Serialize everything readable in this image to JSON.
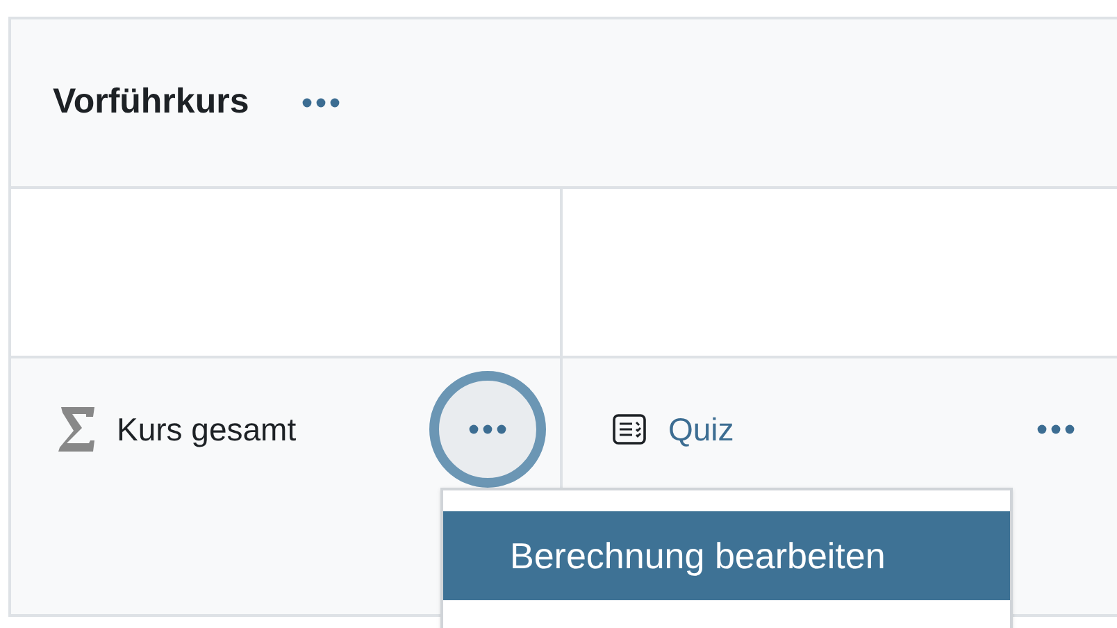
{
  "course": {
    "title": "Vorführkurs"
  },
  "total": {
    "label": "Kurs gesamt"
  },
  "items": [
    {
      "label": "Quiz"
    }
  ],
  "menu": {
    "items": [
      {
        "label": "Berechnung bearbeiten",
        "selected": true
      }
    ]
  }
}
